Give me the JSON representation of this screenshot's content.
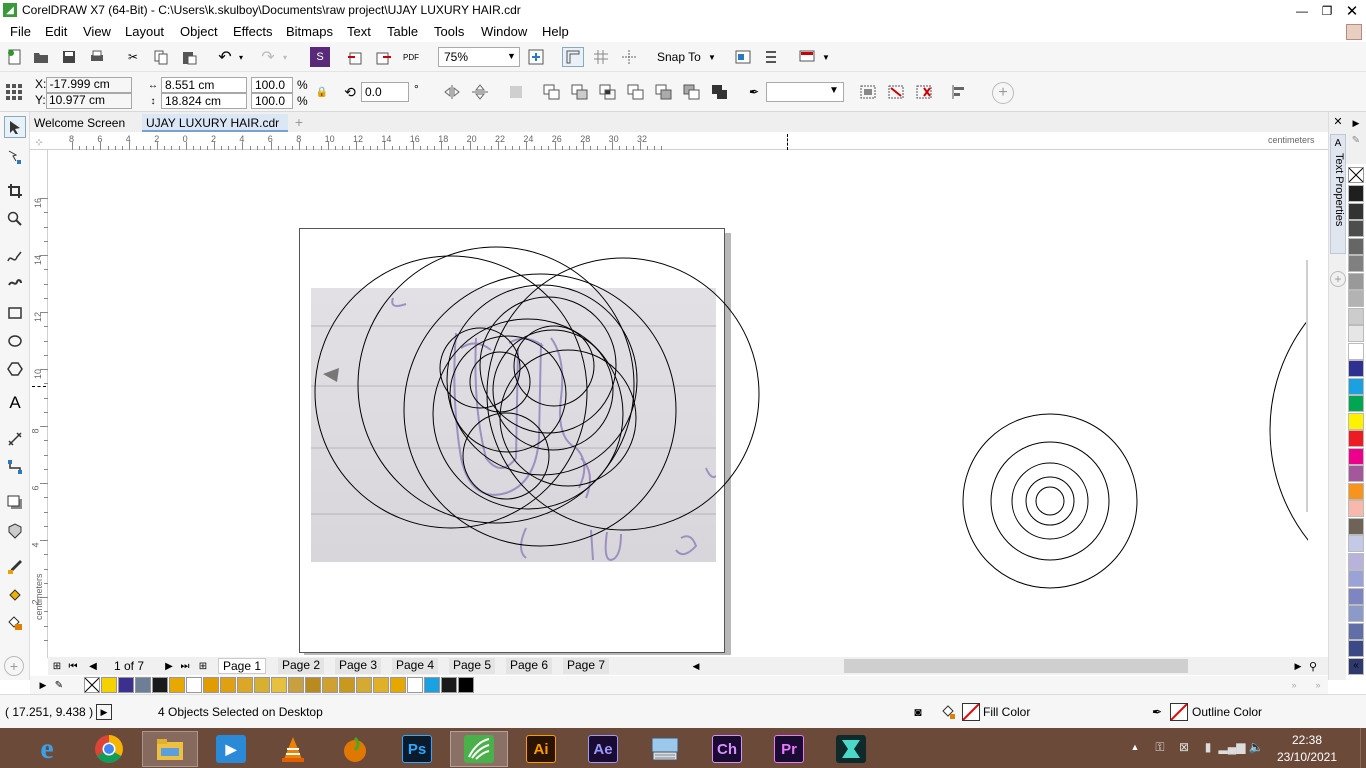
{
  "window": {
    "title": "CorelDRAW X7 (64-Bit) - C:\\Users\\k.skulboy\\Documents\\raw project\\UJAY LUXURY HAIR.cdr"
  },
  "menu": [
    "File",
    "Edit",
    "View",
    "Layout",
    "Object",
    "Effects",
    "Bitmaps",
    "Text",
    "Table",
    "Tools",
    "Window",
    "Help"
  ],
  "standard_toolbar": {
    "zoom": "75%",
    "snap_to": "Snap To"
  },
  "property_bar": {
    "x": "X: -17.999 cm",
    "y": "Y: 10.977 cm",
    "width": "8.551 cm",
    "height": "18.824 cm",
    "scale_w": "100.0",
    "scale_h": "100.0",
    "pct": "%",
    "angle": "0.0",
    "deg": "°"
  },
  "tabs": [
    "Welcome Screen",
    "UJAY LUXURY HAIR.cdr"
  ],
  "ruler_h": [
    "8",
    "6",
    "4",
    "2",
    "0",
    "2",
    "4",
    "6",
    "8",
    "10",
    "12",
    "14",
    "16",
    "18",
    "20",
    "22",
    "24",
    "26",
    "28",
    "30",
    "32"
  ],
  "ruler_h_unit": "centimeters",
  "ruler_v": [
    "16",
    "14",
    "12",
    "10",
    "8",
    "6",
    "4",
    "2"
  ],
  "ruler_v_unit": "centimeters",
  "docker": {
    "label": "Text Properties"
  },
  "pages": {
    "counter": "1 of 7",
    "tabs": [
      "Page 1",
      "Page 2",
      "Page 3",
      "Page 4",
      "Page 5",
      "Page 6",
      "Page 7"
    ]
  },
  "palette": [
    "#1f1f1f",
    "#333333",
    "#4d4d4d",
    "#666666",
    "#808080",
    "#999999",
    "#b3b3b3",
    "#cccccc",
    "#e6e6e6",
    "#ffffff",
    "#2e3192",
    "#1ba1e2",
    "#00a651",
    "#fff200",
    "#ed1c24",
    "#ec008c",
    "#a4579a",
    "#f7941d",
    "#f9b8ac",
    "#6e6259",
    "#c5c9e8",
    "#b7b3dc",
    "#9aa2d8",
    "#7f85c1",
    "#8c9ac9",
    "#626ea8",
    "#3b4a86",
    "#2e3a6e"
  ],
  "doc_palette": [
    "#f5d100",
    "#3c2f8f",
    "#6d7f96",
    "#1a1a1a",
    "#e9a800",
    "#ffffff",
    "#e19c00",
    "#e0a010",
    "#dca628",
    "#d8b030",
    "#e8c040",
    "#c8a040",
    "#b88a20",
    "#d0a030",
    "#c89820",
    "#d4aa30",
    "#e0b028",
    "#e6a800",
    "#ffffff",
    "#1ba1e2",
    "#1a1a1a",
    "#000000"
  ],
  "status": {
    "coords": "( 17.251, 9.438 )",
    "message": "4 Objects Selected on Desktop",
    "fill": "Fill Color",
    "outline": "Outline Color"
  },
  "taskbar": {
    "time": "22:38",
    "date": "23/10/2021",
    "apps": [
      "ie",
      "chrome",
      "explorer",
      "media",
      "vlc",
      "fl-studio",
      "Ps",
      "coreldraw",
      "Ai",
      "Ae",
      "keyboard",
      "Ch",
      "Pr",
      "filmora"
    ]
  }
}
